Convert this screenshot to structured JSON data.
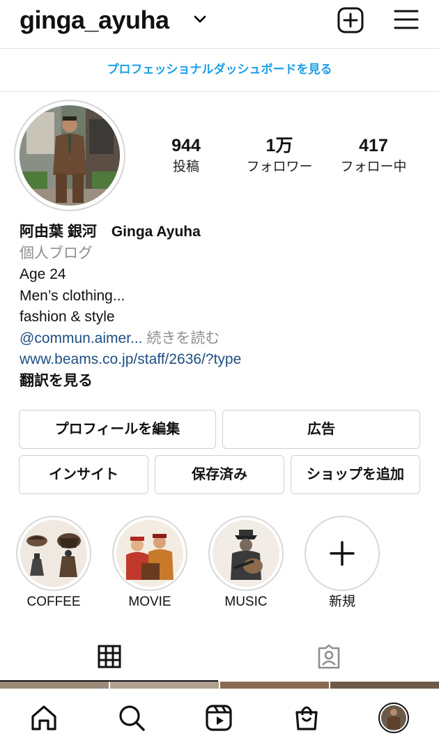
{
  "header": {
    "username": "ginga_ayuha",
    "icons": [
      "chevron-down-icon",
      "new-post-icon",
      "menu-icon"
    ]
  },
  "dashboard_link": "プロフェッショナルダッシュボードを見る",
  "stats": [
    {
      "value": "944",
      "label": "投稿"
    },
    {
      "value": "1万",
      "label": "フォロワー"
    },
    {
      "value": "417",
      "label": "フォロー中"
    }
  ],
  "bio": {
    "name": "阿由葉 銀河　Ginga Ayuha",
    "category": "個人ブログ",
    "lines": [
      "Age 24",
      "Men’s clothing...",
      "fashion & style"
    ],
    "mention": "@commun.aimer...",
    "read_more": "続きを読む",
    "website": "www.beams.co.jp/staff/2636/?type",
    "translate": "翻訳を見る"
  },
  "buttons": {
    "edit_profile": "プロフィールを編集",
    "ads": "広告",
    "insights": "インサイト",
    "saved": "保存済み",
    "add_shop": "ショップを追加"
  },
  "highlights": [
    {
      "label": "COFFEE"
    },
    {
      "label": "MOVIE"
    },
    {
      "label": "MUSIC"
    },
    {
      "label": "新規"
    }
  ],
  "tabs": [
    "grid-icon",
    "tagged-icon"
  ],
  "nav": [
    "home-icon",
    "search-icon",
    "reels-icon",
    "shop-icon",
    "profile-avatar"
  ],
  "colors": {
    "link_blue": "#1b9ee8",
    "bio_link": "#1e4e82",
    "muted": "#8e8e8e"
  }
}
